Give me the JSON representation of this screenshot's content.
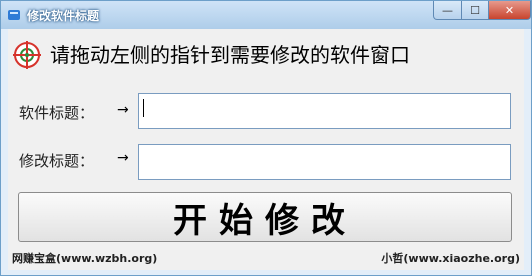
{
  "window": {
    "title": "修改软件标题",
    "minimize_glyph": "—",
    "maximize_glyph": "☐",
    "close_glyph": "✕"
  },
  "instruction": "请拖动左侧的指针到需要修改的软件窗口",
  "form": {
    "software_title_label": "软件标题：",
    "modify_title_label": "修改标题：",
    "arrow": "→",
    "software_title_value": "",
    "modify_title_value": ""
  },
  "start_button": "开始修改",
  "footer": {
    "left": "网赚宝盒(www.wzbh.org)",
    "right": "小哲(www.xiaozhe.org)"
  },
  "colors": {
    "titlebar": "#aecde9",
    "close_button": "#c8442e",
    "crosshair": "#d6332b"
  },
  "icons": [
    "app-icon",
    "crosshair-icon"
  ]
}
